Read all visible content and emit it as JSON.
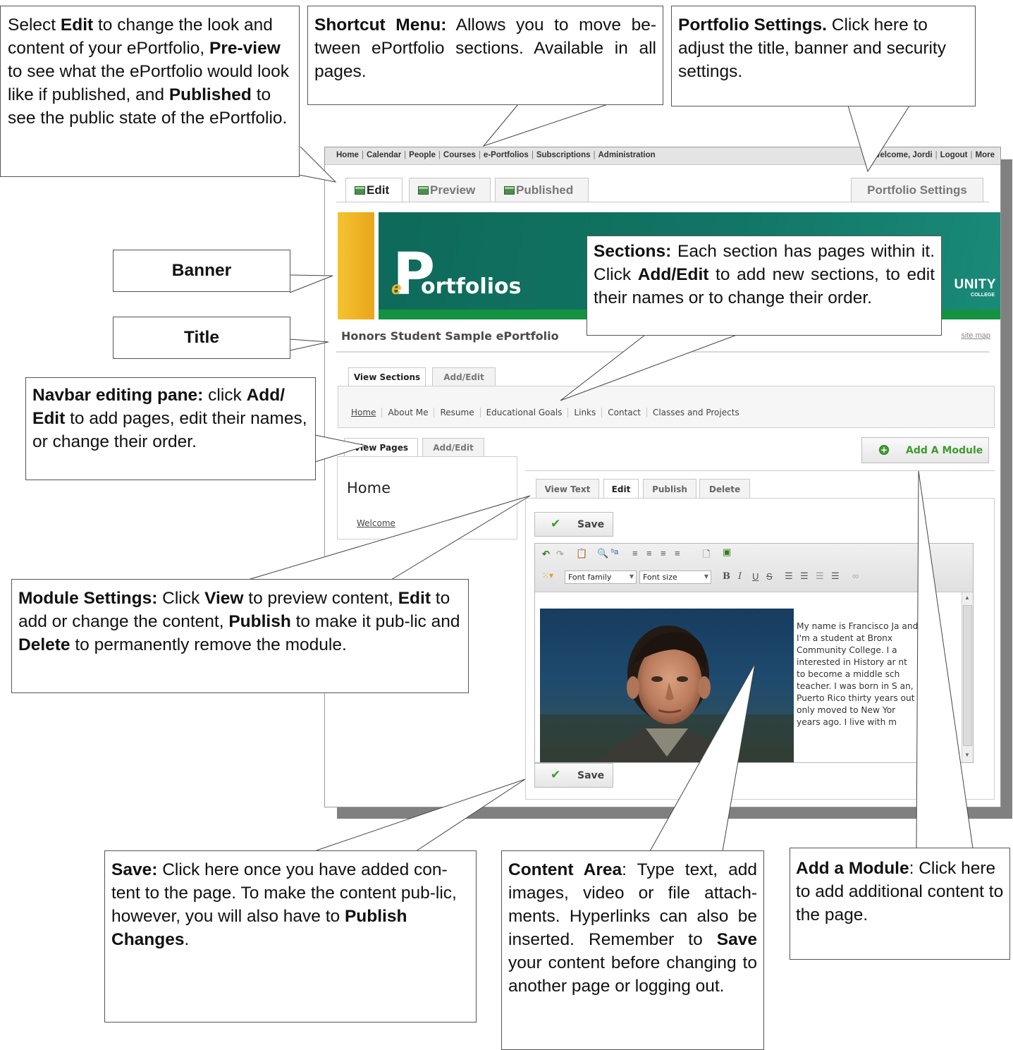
{
  "topnav": {
    "links": [
      "Home",
      "Calendar",
      "People",
      "Courses",
      "e-Portfolios",
      "Subscriptions",
      "Administration"
    ],
    "welcome": "Welcome, Jordi",
    "logout": "Logout",
    "more": "More"
  },
  "view_tabs": [
    "Edit",
    "Preview",
    "Published"
  ],
  "portfolio_settings": "Portfolio Settings",
  "banner": {
    "logo_e": "e",
    "logo_p": "P",
    "logo_rest": "ortfolios",
    "college_text": "UNITY",
    "college_sub": "COLLEGE"
  },
  "portfolio_title": "Honors Student Sample ePortfolio",
  "site_map": "site map",
  "section_tabs": [
    "View Sections",
    "Add/Edit"
  ],
  "sections": [
    "Home",
    "About Me",
    "Resume",
    "Educational Goals",
    "Links",
    "Contact",
    "Classes and Projects"
  ],
  "page_tabs": [
    "View Pages",
    "Add/Edit"
  ],
  "pages_heading": "Home",
  "pages": [
    "Welcome"
  ],
  "add_module": "Add A Module",
  "module_tabs": [
    "View Text",
    "Edit",
    "Publish",
    "Delete"
  ],
  "save_label": "Save",
  "editor": {
    "font_family": "Font family",
    "font_size": "Font size",
    "body_lines": [
      "My name is Francisco Ja     and",
      "I'm a student at Bronx",
      "Community College. I a",
      "interested in History ar          nt",
      "to become a middle sch",
      "teacher. I was born in S          an,",
      "Puerto Rico thirty years          out",
      "only moved to New Yor",
      "years ago. I live with m"
    ]
  },
  "callouts": {
    "edit_preview": "",
    "shortcut": "",
    "settings": "",
    "banner": "Banner",
    "title": "Title",
    "navbar": "",
    "sections": "",
    "module": "",
    "save": "",
    "content": "",
    "add_module": ""
  },
  "accent_colors": {
    "banner_teal": "#127565",
    "banner_green": "#159241",
    "banner_yellow": "#f4c431",
    "add_module_green": "#3f9a2f"
  }
}
